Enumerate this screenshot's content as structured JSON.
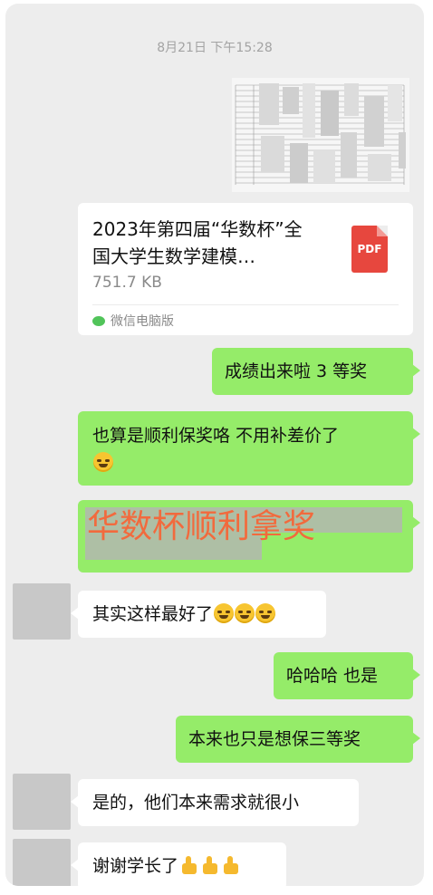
{
  "timestamp": "8月21日 下午15:28",
  "file": {
    "title": "2023年第四届“华数杯”全国大学生数学建模…",
    "size": "751.7 KB",
    "type_label": "PDF",
    "source": "微信电脑版"
  },
  "messages": {
    "m1": "成绩出来啦  3 等奖",
    "m2": "也算是顺利保奖咯 不用补差价了",
    "m3": "华数杯顺利拿奖",
    "m4": "其实这样最好了",
    "m5": "哈哈哈 也是",
    "m6": "本来也只是想保三等奖",
    "m7": "是的，他们本来需求就很小",
    "m8": "谢谢学长了"
  },
  "colors": {
    "sent_bubble": "#95ec69",
    "received_bubble": "#ffffff",
    "background": "#ededed",
    "highlight_text": "#f26a3d",
    "pdf": "#e7473e"
  }
}
